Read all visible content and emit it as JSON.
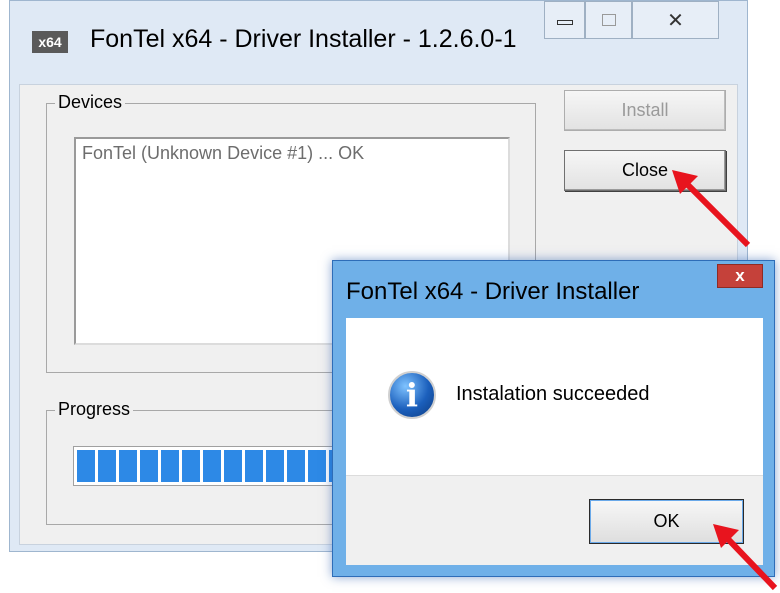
{
  "main_window": {
    "icon_text": "x64",
    "title": "FonTel x64 - Driver Installer - 1.2.6.0-1",
    "devices_label": "Devices",
    "devices": [
      "FonTel (Unknown Device #1) ... OK"
    ],
    "install_label": "Install",
    "close_label": "Close",
    "progress_label": "Progress",
    "progress_value": 1.0
  },
  "dialog": {
    "title": "FonTel x64 - Driver Installer",
    "close_glyph": "x",
    "message": "Instalation succeeded",
    "ok_label": "OK",
    "icon": "info-icon"
  },
  "annotations": {
    "arrow_color": "#e8141e"
  }
}
